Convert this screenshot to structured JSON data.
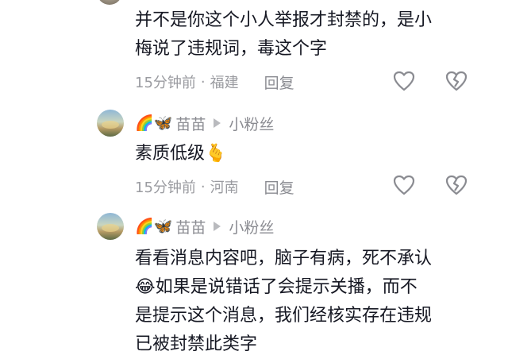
{
  "comments": [
    {
      "text_lines": [
        "并不是你这个小人举报才封禁的，是小",
        "梅说了违规词，毒这个字"
      ],
      "time": "15分钟前",
      "location": "福建",
      "reply_label": "回复"
    },
    {
      "username": "苗苗",
      "deco_emoji": "🌈🦋",
      "reply_to": "小粉丝",
      "text": "素质低级",
      "text_emoji": "🫰",
      "time": "15分钟前",
      "location": "河南",
      "reply_label": "回复"
    },
    {
      "username": "苗苗",
      "deco_emoji": "🌈🦋",
      "reply_to": "小粉丝",
      "text_lines": [
        "看看消息内容吧，脑子有病，死不承认",
        "如果是说错话了会提示关播，而不",
        "是提示这个消息，我们经核实存在违规",
        "已被封禁此类字"
      ],
      "line2_emoji": "😂"
    }
  ],
  "icons": {
    "like": "heart-outline-icon",
    "dislike": "broken-heart-icon",
    "reply_arrow": "play-triangle-icon"
  }
}
